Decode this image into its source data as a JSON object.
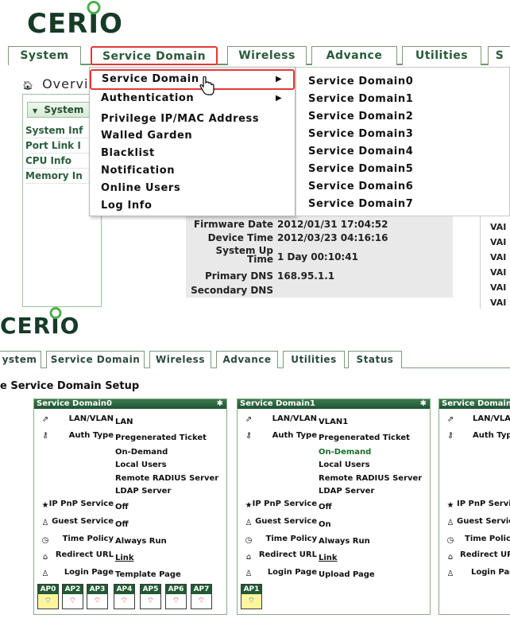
{
  "logo_text": {
    "pre": "CER",
    "dot": "I",
    "post": "O"
  },
  "top_tabs": [
    "System",
    "Service Domain",
    "Wireless",
    "Advance",
    "Utilities",
    "S"
  ],
  "overview_title": "Overvi",
  "system_section": "System",
  "left_links": [
    "System Inf",
    "Port Link I",
    "CPU Info",
    "Memory In"
  ],
  "menu": {
    "items": [
      "Service Domain",
      "Authentication",
      "Privilege IP/MAC Address",
      "Walled Garden",
      "Blacklist",
      "Notification",
      "Online Users",
      "Log Info"
    ],
    "arrow": "▶"
  },
  "submenu": [
    "Service Domain0",
    "Service Domain1",
    "Service Domain2",
    "Service Domain3",
    "Service Domain4",
    "Service Domain5",
    "Service Domain6",
    "Service Domain7"
  ],
  "info": [
    {
      "label": "Firmware Date",
      "value": "2012/01/31 17:04:52"
    },
    {
      "label": "Device Time",
      "value": "2012/03/23 04:16:16"
    },
    {
      "label": "System Up",
      "label2": "Time",
      "value": "1 Day 00:10:41"
    },
    {
      "label": "Primary DNS",
      "value": "168.95.1.1"
    },
    {
      "label": "Secondary DNS",
      "value": ""
    }
  ],
  "right_vals": [
    "VAI",
    "VAI",
    "VAI",
    "VAI",
    "VAI",
    "VAI"
  ],
  "second_tabs": [
    "ystem",
    "Service Domain",
    "Wireless",
    "Advance",
    "Utilities",
    "Status"
  ],
  "setup_title": "e  Service Domain Setup",
  "cards": [
    {
      "title": "Service Domain0",
      "lan": "LAN",
      "auth": [
        "Pregenerated Ticket",
        "On-Demand",
        "Local Users",
        "Remote RADIUS Server",
        "LDAP Server"
      ],
      "ippnp": "Off",
      "guest": "Off",
      "time": "Always Run",
      "redirect": "Link",
      "login": "Template Page",
      "aps": [
        "AP0",
        "AP2",
        "AP3",
        "AP4",
        "AP5",
        "AP6",
        "AP7"
      ]
    },
    {
      "title": "Service Domain1",
      "lan": "VLAN1",
      "auth": [
        "Pregenerated Ticket",
        "On-Demand",
        "Local Users",
        "Remote RADIUS Server",
        "LDAP Server"
      ],
      "ippnp": "Off",
      "guest": "On",
      "time": "Always Run",
      "redirect": "Link",
      "login": "Upload Page",
      "aps": [
        "AP1"
      ]
    },
    {
      "title": "Service Domain",
      "lan": "",
      "auth": [],
      "ippnp": "",
      "guest": "",
      "time": "",
      "redirect": "",
      "login": "",
      "aps": []
    }
  ],
  "row_labels": {
    "lan": "LAN/VLAN",
    "auth": "Auth Type",
    "ippnp": "IP PnP Service",
    "guest": "Guest Service",
    "time": "Time Policy",
    "redirect": "Redirect URL",
    "login": "Login Page"
  },
  "row_labels_cut": {
    "lan": "LAN/VLAI",
    "auth": "Auth Type",
    "ippnp": "IP PnP Service",
    "guest": "Guest Service",
    "time": "Time Policy",
    "redirect": "Redirect URL",
    "login": "Login Page"
  },
  "icons": {
    "lan": "link-icon",
    "auth": "key-icon",
    "ippnp": "star-icon",
    "guest": "user-icon",
    "time": "clock-icon",
    "redirect": "home-icon",
    "login": "user-icon",
    "gear": "gear-icon",
    "wifi": "wifi-icon",
    "hand": "hand-cursor-icon"
  },
  "colors": {
    "accent_red": "#e53935",
    "dark_green": "#1f5333",
    "ap_active_bg": "#fff59d"
  }
}
